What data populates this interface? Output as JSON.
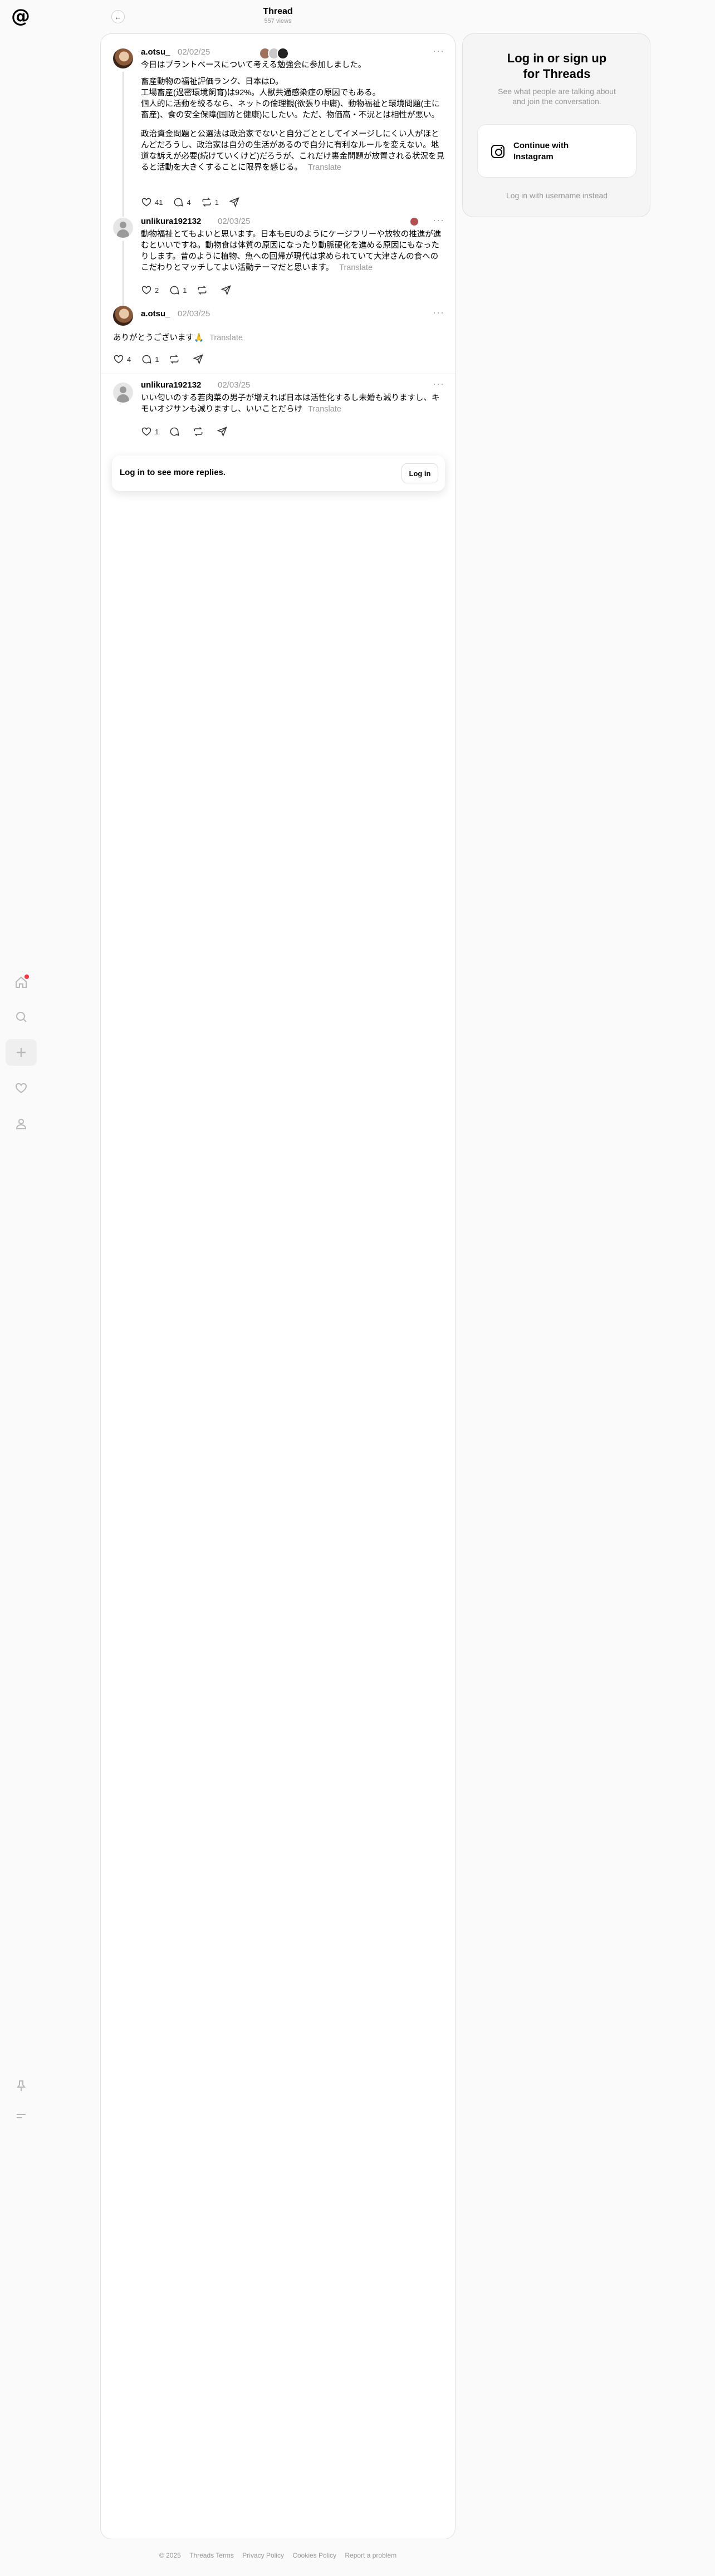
{
  "header": {
    "title": "Thread",
    "views": "557 views"
  },
  "nav": {
    "items": [
      "home",
      "search",
      "create",
      "activity",
      "profile"
    ],
    "bottom": [
      "pin",
      "menu"
    ]
  },
  "posts": [
    {
      "username": "a.otsu_",
      "date": "02/02/25",
      "lines": [
        "今日はプラントベースについて考える勉強会に参加しました。",
        "",
        "畜産動物の福祉評価ランク、日本はD。",
        "工場畜産(過密環境飼育)は92%。人獣共通感染症の原因でもある。",
        "個人的に活動を絞るなら、ネットの倫理観(欲張り中庸)、動物福祉と環境問題(主に畜産)、食の安全保障(国防と健康)にしたい。ただ、物価高・不況とは相性が悪い。",
        "",
        "政治資金問題と公選法は政治家でないと自分ごととしてイメージしにくい人がほとんどだろうし、政治家は自分の生活があるので自分に有利なルールを変えない。地道な訴えが必要(続けていくけど)だろうが、これだけ裏金問題が放置される状況を見ると活動を大きくすることに限界を感じる。"
      ],
      "translate": "Translate",
      "likes": "41",
      "comments": "4",
      "reposts": "1"
    },
    {
      "username": "unlikura192132",
      "date": "02/03/25",
      "text": "動物福祉とてもよいと思います。日本もEUのようにケージフリーや放牧の推進が進むといいですね。動物食は体質の原因になったり動脈硬化を進める原因にもなったりします。昔のように植物、魚への回帰が現代は求められていて大津さんの食へのこだわりとマッチしてよい活動テーマだと思います。",
      "translate": "Translate",
      "likes": "2",
      "comments": "1"
    },
    {
      "username": "a.otsu_",
      "date": "02/03/25",
      "text": "ありがとうございます🙏",
      "translate": "Translate",
      "likes": "4",
      "comments": "1"
    },
    {
      "username": "unlikura192132",
      "date": "02/03/25",
      "text": "いい匂いのする若肉菜の男子が増えれば日本は活性化するし未婚も減りますし、キモいオジサンも減りますし、いいことだらけ",
      "translate": "Translate",
      "likes": "1"
    }
  ],
  "more_replies": {
    "text": "Log in to see more replies.",
    "button": "Log in"
  },
  "login_card": {
    "title": "Log in or sign up for Threads",
    "subtitle": "See what people are talking about and join the conversation.",
    "instagram_button": "Continue with Instagram",
    "username_link": "Log in with username instead"
  },
  "footer": [
    "© 2025",
    "Threads Terms",
    "Privacy Policy",
    "Cookies Policy",
    "Report a problem"
  ]
}
